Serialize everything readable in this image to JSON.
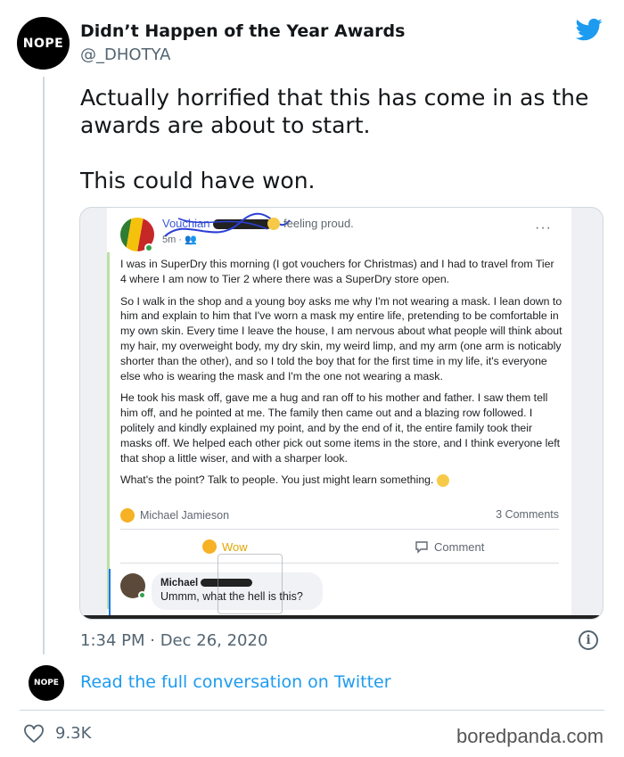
{
  "tweet": {
    "avatar_text": "NOPE",
    "author_name": "Didn’t Happen of the Year Awards",
    "handle": "@_DHOTYA",
    "text_lines": [
      "Actually horrified that this has come in as the awards are about to start.",
      "This could have won."
    ],
    "timestamp": "1:34 PM · Dec 26, 2020",
    "read_link": "Read the full conversation on Twitter",
    "like_count": "9.3K",
    "icons": {
      "bird": "twitter-bird-icon",
      "info": "info-icon",
      "heart": "heart-icon"
    },
    "colors": {
      "accent": "#1d9bf0",
      "text": "#14171a",
      "muted": "#536471"
    }
  },
  "fb_post": {
    "author_partial": "Vouchian",
    "feeling": "feeling proud.",
    "time": "5m · ",
    "more": "···",
    "paragraphs": [
      "I was in SuperDry this morning (I got vouchers for Christmas) and I had to travel from Tier 4 where I am now to Tier 2 where there was a SuperDry store open.",
      "So I walk in the shop and a young boy asks me why I'm not wearing a mask. I lean down to him and explain to him that I've worn a mask my entire life, pretending to be comfortable in my own skin. Every time I leave the house, I am nervous about what people will think about my hair, my overweight body, my dry skin, my weird limp, and my arm (one arm is noticably shorter than the other), and so I told the boy that for the first time in my life, it's everyone else who is wearing the mask and I'm the one not wearing a mask.",
      "He took his mask off, gave me a hug and ran off to his mother and father. I saw them tell him off, and he pointed at me. The family then came out and a blazing row followed. I politely and kindly explained my point, and by the end of it, the entire family took their masks off. We helped each other pick out some items in the store, and I think everyone left that shop a little wiser, and with a sharper look.",
      "What's the point? Talk to people. You just might learn something."
    ],
    "reactor": "Michael Jamieson",
    "comment_count": "3 Comments",
    "wow_label": "Wow",
    "comment_label": "Comment",
    "comment": {
      "author_partial": "Michael",
      "text": "Ummm, what the hell is this?"
    }
  },
  "watermark": "boredpanda.com"
}
